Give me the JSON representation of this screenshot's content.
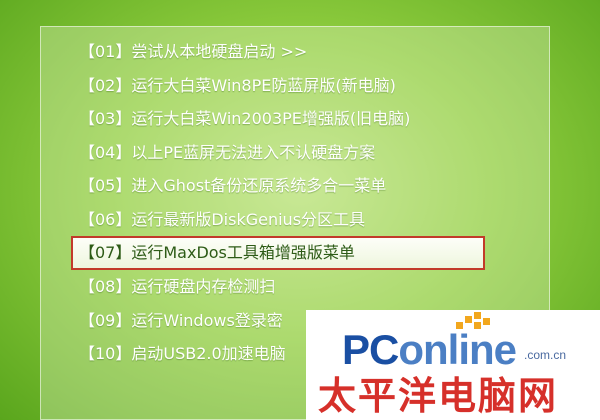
{
  "menu": {
    "items": [
      "【01】尝试从本地硬盘启动 >>",
      "【02】运行大白菜Win8PE防蓝屏版(新电脑)",
      "【03】运行大白菜Win2003PE增强版(旧电脑)",
      "【04】以上PE蓝屏无法进入不认硬盘方案",
      "【05】进入Ghost备份还原系统多合一菜单",
      "【06】运行最新版DiskGenius分区工具",
      "【07】运行MaxDos工具箱增强版菜单",
      "【08】运行硬盘内存检测扫",
      "【09】运行Windows登录密",
      "【10】启动USB2.0加速电脑"
    ],
    "selected_index": 6
  },
  "watermark": {
    "brand_a": "PC",
    "brand_b": "online",
    "domain": ".com.cn",
    "cn_name": "太平洋电脑网"
  },
  "colors": {
    "background": "#8fcd3f",
    "selection_border": "#c23a2a",
    "brand_blue": "#1a4fa3",
    "brand_red": "#d6302a",
    "brand_orange": "#f2a71e"
  }
}
